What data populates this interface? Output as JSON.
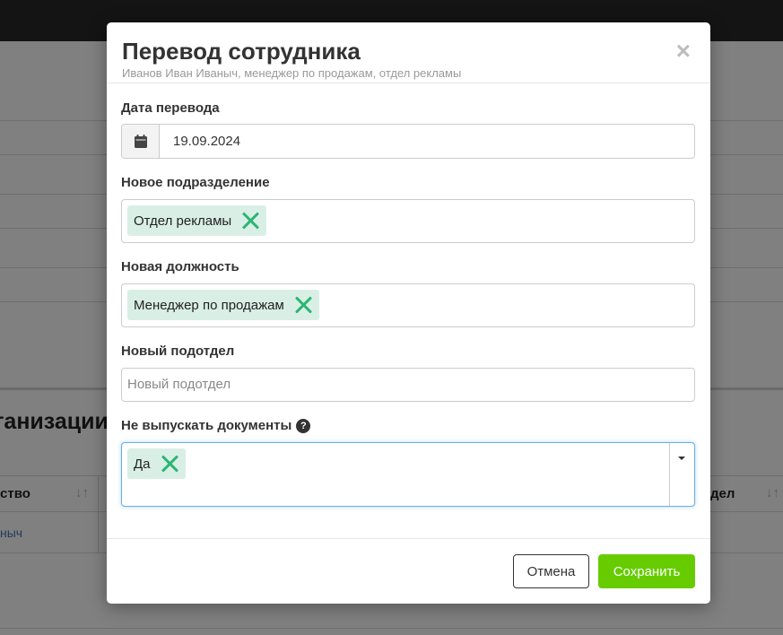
{
  "background": {
    "heading": "ганизации",
    "col_left": "ство",
    "col_right": "дел",
    "link": "ныч",
    "sort_glyph": "↓↑"
  },
  "modal": {
    "title": "Перевод сотрудника",
    "subtitle": "Иванов Иван Иваныч, менеджер по продажам, отдел рекламы",
    "close_glyph": "×"
  },
  "form": {
    "date": {
      "label": "Дата перевода",
      "value": "19.09.2024",
      "icon": "calendar-icon"
    },
    "department": {
      "label": "Новое подразделение",
      "selected": "Отдел рекламы"
    },
    "position": {
      "label": "Новая должность",
      "selected": "Менеджер по продажам"
    },
    "subdivision": {
      "label": "Новый подотдел",
      "placeholder": "Новый подотдел",
      "value": ""
    },
    "no_docs": {
      "label": "Не выпускать документы",
      "help": "?",
      "selected": "Да"
    }
  },
  "footer": {
    "cancel_label": "Отмена",
    "save_label": "Сохранить"
  },
  "colors": {
    "tag_bg": "#d9efe6",
    "tag_remove": "#2bb673",
    "save_bg": "#66cc00",
    "focus_border": "#66afe9"
  }
}
